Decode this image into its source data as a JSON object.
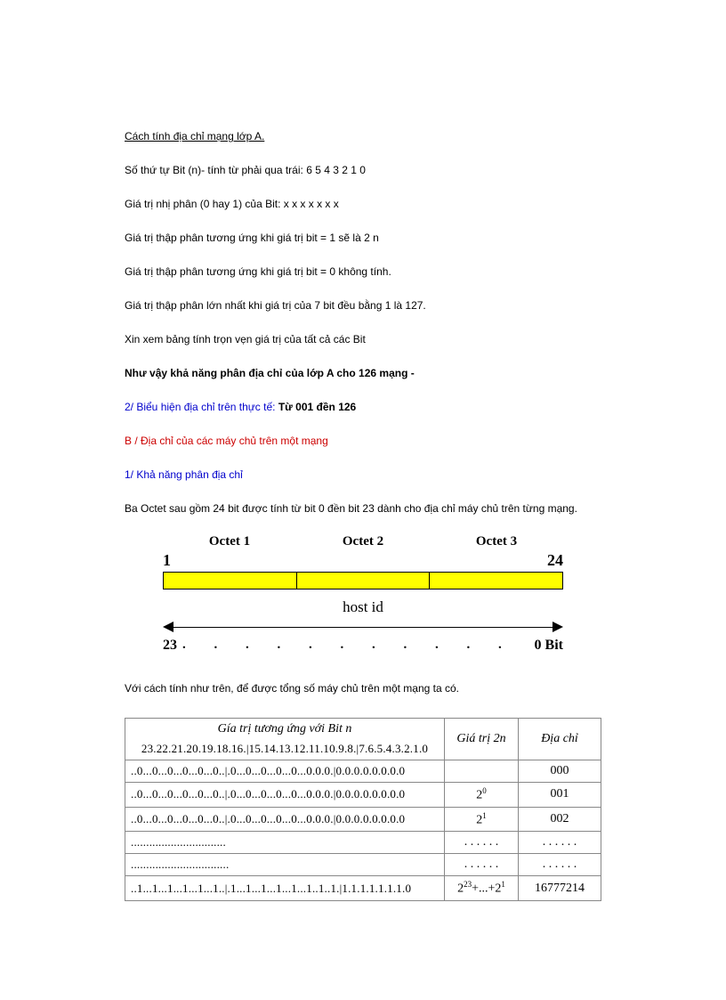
{
  "title": "Cách tính địa chỉ mạng lớp A.",
  "p1": "Số thứ tự Bit (n)- tính từ phải qua trái: 6 5 4 3 2 1 0",
  "p2": "Giá trị nhị phân (0 hay 1) của Bit: x x x x x x x",
  "p3": "Giá trị thập phân tương ứng khi giá trị bit = 1 sẽ là 2 n",
  "p4": "Giá trị thập phân tương ứng khi giá trị bit = 0 không tính.",
  "p5": "Giá trị thập phân lớn nhất khi giá trị của 7 bit đều bằng 1 là 127.",
  "p6": "Xin xem bảng tính trọn vẹn giá trị của tất cả các Bit",
  "p7": "Như vậy khả năng phân địa chỉ của lớp A cho 126 mạng -",
  "p8a": "2/ Biểu hiện địa chỉ trên thực tế: ",
  "p8b": "Từ 001 đền 126",
  "p9": "B / Địa chỉ của các máy chủ trên một mạng",
  "p10": "1/ Khả năng phân địa chỉ",
  "p11": "Ba Octet sau gồm 24 bit được tính từ bit 0 đền bit 23 dành cho địa chỉ máy chủ trên từng mạng.",
  "diagram": {
    "oct1": "Octet 1",
    "oct2": "Octet 2",
    "oct3": "Octet 3",
    "top_left": "1",
    "top_right": "24",
    "hostid": "host id",
    "bot_left": "23",
    "bot_right": "0 Bit",
    "ticks": ". . . . . . . . . . . . ."
  },
  "p12": "Với cách tính như trên, để được tổng số máy chủ trên một mạng ta có.",
  "table": {
    "header_main": "Gía trị tương ứng với Bit n",
    "header_bits": "23.22.21.20.19.18.16.|15.14.13.12.11.10.9.8.|7.6.5.4.3.2.1.0",
    "header_gia": "Giá  trị 2n",
    "header_dia": "Địa chỉ",
    "rows": [
      {
        "bits": "..0...0...0...0...0...0..|.0...0...0...0...0...0.0.0.|0.0.0.0.0.0.0.0",
        "gia_html": "",
        "dia": "000"
      },
      {
        "bits": "..0...0...0...0...0...0..|.0...0...0...0...0...0.0.0.|0.0.0.0.0.0.0.0",
        "gia_html": "2<sup>0</sup>",
        "dia": "001"
      },
      {
        "bits": "..0...0...0...0...0...0..|.0...0...0...0...0...0.0.0.|0.0.0.0.0.0.0.0",
        "gia_html": "2<sup>1</sup>",
        "dia": "002"
      },
      {
        "bits": "...............................",
        "gia_html": ". . . . . .",
        "dia": ". . . . . ."
      },
      {
        "bits": "................................",
        "gia_html": ". . . . . .",
        "dia": ". . . . . ."
      },
      {
        "bits": "..1...1...1...1...1...1..|.1...1...1...1...1...1..1..1.|1.1.1.1.1.1.1.0",
        "gia_html": "2<sup>23</sup>+...+2<sup>1</sup>",
        "dia": "16777214"
      }
    ]
  }
}
